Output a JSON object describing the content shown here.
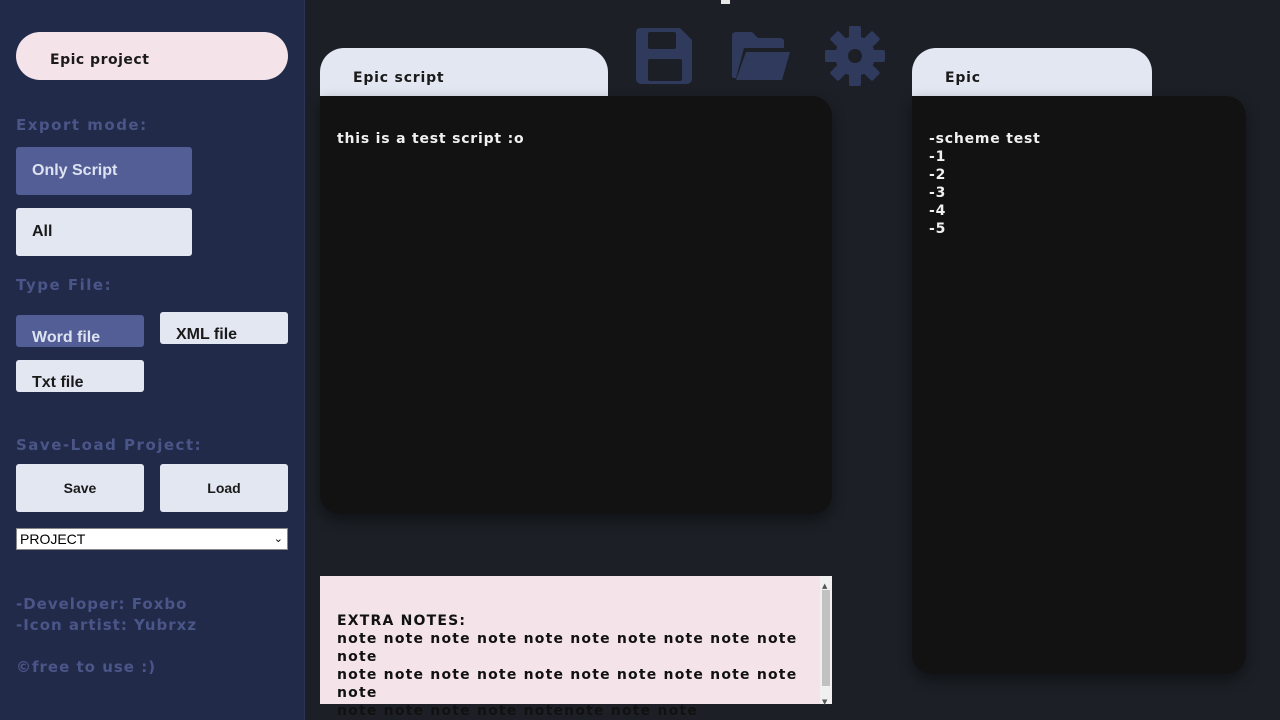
{
  "sidebar": {
    "project_name": "Epic project",
    "export_mode_label": "Export mode:",
    "export_options": [
      "Only Script",
      "All"
    ],
    "type_file_label": "Type File:",
    "type_options": [
      "Word file",
      "XML file",
      "Txt file"
    ],
    "save_load_label": "Save-Load Project:",
    "save_label": "Save",
    "load_label": "Load",
    "project_select": "PROJECT",
    "credit_developer": "-Developer: Foxbo",
    "credit_icon_artist": "-Icon artist: Yubrxz",
    "free_note": "©free to use :)"
  },
  "toolbar": {
    "icons": [
      "floppy-disk-icon",
      "folder-icon",
      "gear-icon"
    ],
    "icon_color": "#2f3a5c"
  },
  "script": {
    "tab_label": "Epic script",
    "content": "this is a test script :o"
  },
  "scheme": {
    "tab_label": "Epic",
    "lines": [
      "-scheme test",
      "-1",
      "-2",
      "-3",
      "-4",
      "-5"
    ]
  },
  "notes": {
    "heading": "EXTRA NOTES:",
    "lines": [
      "note note note note note note note note note note note",
      "note note note note note note note note note note note",
      "note note note note notenote note note"
    ]
  },
  "colors": {
    "sidebar_bg": "#222a4a",
    "accent_dark": "#535e97",
    "accent_light": "#e2e7f2",
    "pink": "#f5e3ea",
    "panel_bg": "#121212",
    "page_bg": "#1c2026"
  }
}
